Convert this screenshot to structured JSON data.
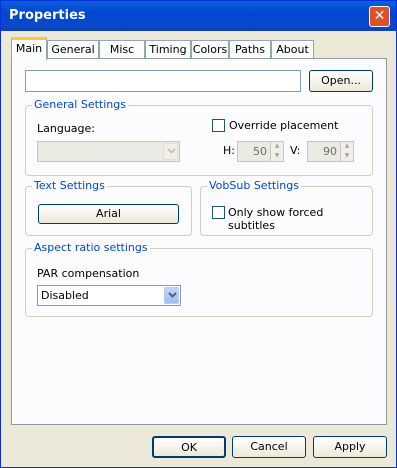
{
  "window": {
    "title": "Properties",
    "close_glyph": "✕"
  },
  "tabs": [
    {
      "label": "Main",
      "active": true
    },
    {
      "label": "General"
    },
    {
      "label": "Misc"
    },
    {
      "label": "Timing"
    },
    {
      "label": "Colors"
    },
    {
      "label": "Paths"
    },
    {
      "label": "About"
    }
  ],
  "main": {
    "file_path_value": "",
    "open_button": "Open...",
    "general_settings": {
      "group_label": "General Settings",
      "language_label": "Language:",
      "language_value": "",
      "override_placement_label": "Override placement",
      "override_placement_checked": false,
      "h_label": "H:",
      "h_value": "50",
      "v_label": "V:",
      "v_value": "90"
    },
    "text_settings": {
      "group_label": "Text Settings",
      "font_button": "Arial"
    },
    "vobsub_settings": {
      "group_label": "VobSub Settings",
      "forced_only_label": "Only show forced subtitles",
      "forced_only_checked": false
    },
    "aspect_ratio": {
      "group_label": "Aspect ratio settings",
      "par_label": "PAR compensation",
      "par_value": "Disabled"
    }
  },
  "footer": {
    "ok": "OK",
    "cancel": "Cancel",
    "apply": "Apply"
  }
}
